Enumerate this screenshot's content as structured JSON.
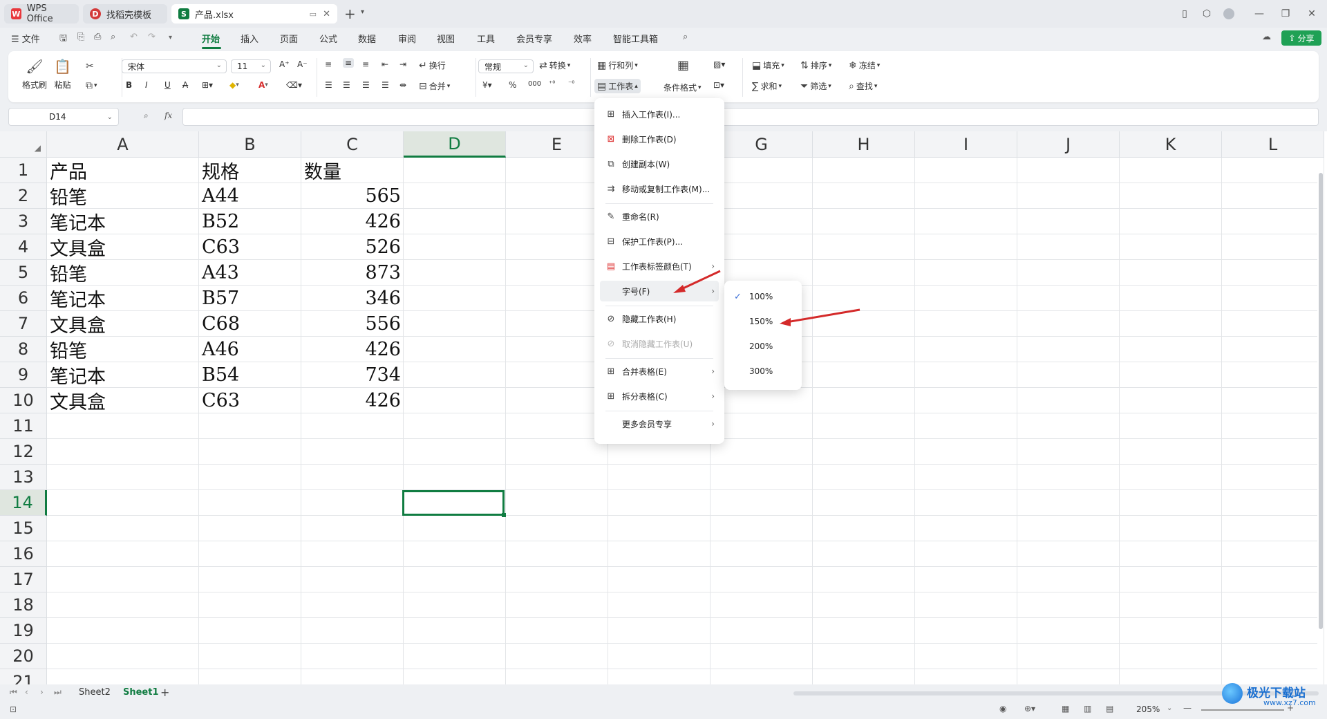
{
  "titlebar": {
    "tabs": [
      {
        "label": "WPS Office",
        "logo": "W"
      },
      {
        "label": "找稻壳模板",
        "logo": "D"
      },
      {
        "label": "产品.xlsx",
        "logo": "S"
      }
    ],
    "new_tab": "+",
    "colors": {
      "wps_red": "#e8383d",
      "sheet_green": "#107c41",
      "doc_red": "#d33a3a"
    }
  },
  "menubar": {
    "file": "文件",
    "items": [
      "开始",
      "插入",
      "页面",
      "公式",
      "数据",
      "审阅",
      "视图",
      "工具",
      "会员专享",
      "效率",
      "智能工具箱"
    ],
    "active": "开始",
    "share": "分享"
  },
  "ribbon": {
    "format_painter": "格式刷",
    "paste": "粘贴",
    "font_name": "宋体",
    "font_size": "11",
    "wrap": "换行",
    "merge": "合并",
    "number_format": "常规",
    "convert": "转换",
    "rows_cols": "行和列",
    "worksheet": "工作表",
    "cond_format": "条件格式",
    "fill": "填充",
    "sort": "排序",
    "freeze": "冻结",
    "sum": "求和",
    "filter": "筛选",
    "find": "查找"
  },
  "formulabar": {
    "cell_ref": "D14",
    "fx": "fx"
  },
  "sheet": {
    "columns": [
      "A",
      "B",
      "C",
      "D",
      "E",
      "F",
      "G",
      "H",
      "I",
      "J",
      "K",
      "L"
    ],
    "selected_column": "D",
    "selected_row": "14",
    "rows": [
      "1",
      "2",
      "3",
      "4",
      "5",
      "6",
      "7",
      "8",
      "9",
      "10",
      "11",
      "12",
      "13",
      "14",
      "15",
      "16",
      "17",
      "18",
      "19",
      "20",
      "21"
    ],
    "data": [
      [
        "产品",
        "规格",
        "数量"
      ],
      [
        "铅笔",
        "A44",
        "565"
      ],
      [
        "笔记本",
        "B52",
        "426"
      ],
      [
        "文具盒",
        "C63",
        "526"
      ],
      [
        "铅笔",
        "A43",
        "873"
      ],
      [
        "笔记本",
        "B57",
        "346"
      ],
      [
        "文具盒",
        "C68",
        "556"
      ],
      [
        "铅笔",
        "A46",
        "426"
      ],
      [
        "笔记本",
        "B54",
        "734"
      ],
      [
        "文具盒",
        "C63",
        "426"
      ]
    ]
  },
  "worksheet_menu": {
    "items": [
      {
        "label": "插入工作表(I)...",
        "icon": "insert-sheet-icon"
      },
      {
        "label": "删除工作表(D)",
        "icon": "delete-sheet-icon"
      },
      {
        "label": "创建副本(W)",
        "icon": "copy-sheet-icon"
      },
      {
        "label": "移动或复制工作表(M)...",
        "icon": "move-sheet-icon"
      },
      {
        "label": "重命名(R)",
        "icon": "rename-icon"
      },
      {
        "label": "保护工作表(P)...",
        "icon": "protect-sheet-icon"
      },
      {
        "label": "工作表标签颜色(T)",
        "icon": "tab-color-icon"
      },
      {
        "label": "字号(F)",
        "icon": ""
      },
      {
        "label": "隐藏工作表(H)",
        "icon": "hide-sheet-icon"
      },
      {
        "label": "取消隐藏工作表(U)",
        "icon": "unhide-sheet-icon"
      },
      {
        "label": "合并表格(E)",
        "icon": "merge-table-icon"
      },
      {
        "label": "拆分表格(C)",
        "icon": "split-table-icon"
      },
      {
        "label": "更多会员专享",
        "icon": ""
      }
    ],
    "font_size_submenu": [
      "100%",
      "150%",
      "200%",
      "300%"
    ],
    "checked": "100%"
  },
  "sheettabs": {
    "tabs": [
      "Sheet2",
      "Sheet1"
    ],
    "active": "Sheet1",
    "add": "+"
  },
  "statusbar": {
    "zoom": "205%"
  },
  "watermark": {
    "text": "极光下载站",
    "url": "www.xz7.com"
  }
}
